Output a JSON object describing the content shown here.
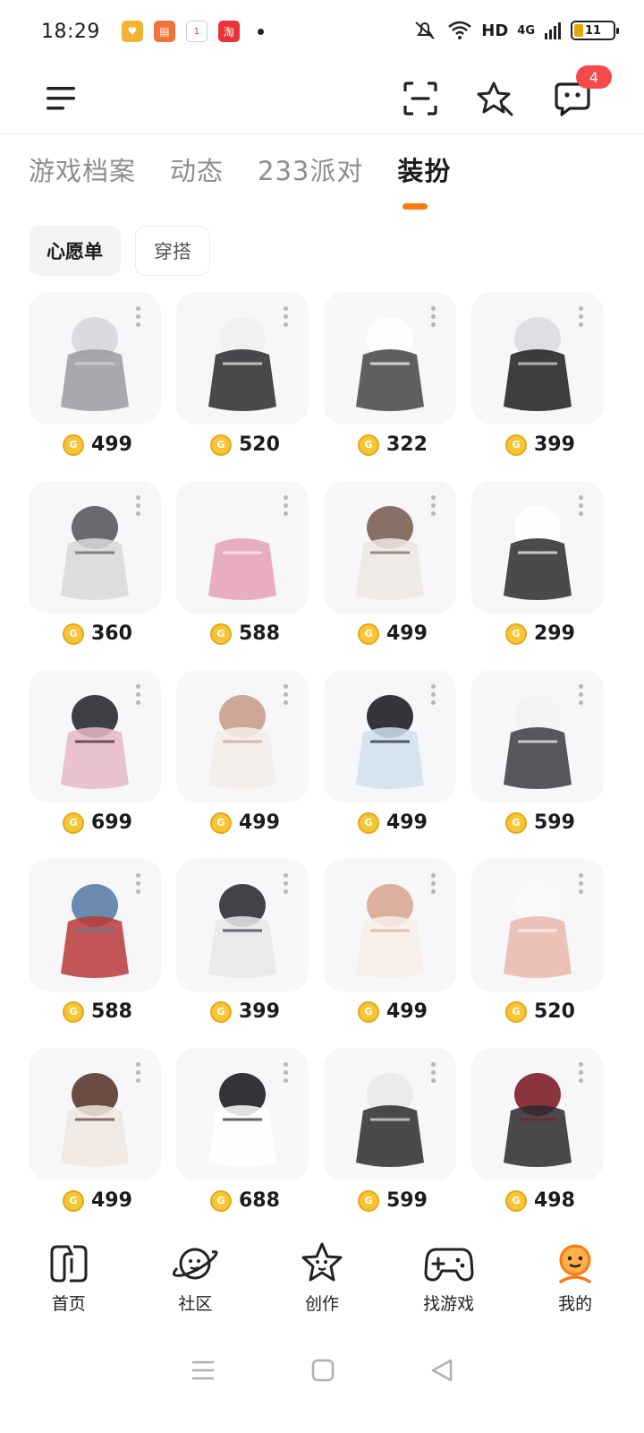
{
  "status_bar": {
    "time": "18:29",
    "network": "HD",
    "cell": "4G",
    "battery": "11"
  },
  "header": {
    "message_badge": "4"
  },
  "tabs": [
    {
      "label": "游戏档案",
      "active": false
    },
    {
      "label": "动态",
      "active": false
    },
    {
      "label": "233派对",
      "active": false
    },
    {
      "label": "装扮",
      "active": true
    }
  ],
  "filters": [
    {
      "label": "心愿单",
      "active": true
    },
    {
      "label": "穿搭",
      "active": false
    }
  ],
  "items": [
    {
      "name": "long-gray-hair",
      "price": "499"
    },
    {
      "name": "black-white-dress-outfit",
      "price": "520"
    },
    {
      "name": "bow-sleep-accessory",
      "price": "322"
    },
    {
      "name": "shoes-with-socks",
      "price": "399"
    },
    {
      "name": "gray-tutu-skirt",
      "price": "360"
    },
    {
      "name": "white-jacket-cat-ears",
      "price": "588"
    },
    {
      "name": "bun-hairstyle",
      "price": "499"
    },
    {
      "name": "maid-headband",
      "price": "299"
    },
    {
      "name": "cropped-black-jacket",
      "price": "699"
    },
    {
      "name": "light-brown-long-hair",
      "price": "499"
    },
    {
      "name": "black-hair-bear-ears",
      "price": "499"
    },
    {
      "name": "white-hoodie-plaid-skirt",
      "price": "599"
    },
    {
      "name": "plaid-jeans",
      "price": "588"
    },
    {
      "name": "platform-sneakers",
      "price": "399"
    },
    {
      "name": "pink-long-hair",
      "price": "499"
    },
    {
      "name": "white-shorts-legs",
      "price": "520"
    },
    {
      "name": "brown-pinafore-dress",
      "price": "499"
    },
    {
      "name": "black-white-paw-dress",
      "price": "688"
    },
    {
      "name": "striped-top-shorts",
      "price": "599"
    },
    {
      "name": "red-leg-warmers-boots",
      "price": "498"
    }
  ],
  "bottom_nav": [
    {
      "label": "首页",
      "icon": "home-icon",
      "active": false
    },
    {
      "label": "社区",
      "icon": "planet-icon",
      "active": false
    },
    {
      "label": "创作",
      "icon": "star-face-icon",
      "active": false
    },
    {
      "label": "找游戏",
      "icon": "gamepad-icon",
      "active": false
    },
    {
      "label": "我的",
      "icon": "profile-icon",
      "active": true
    }
  ],
  "colors": {
    "accent": "#ff7a10",
    "badge": "#f44a4a",
    "coin": "#f6c636"
  }
}
